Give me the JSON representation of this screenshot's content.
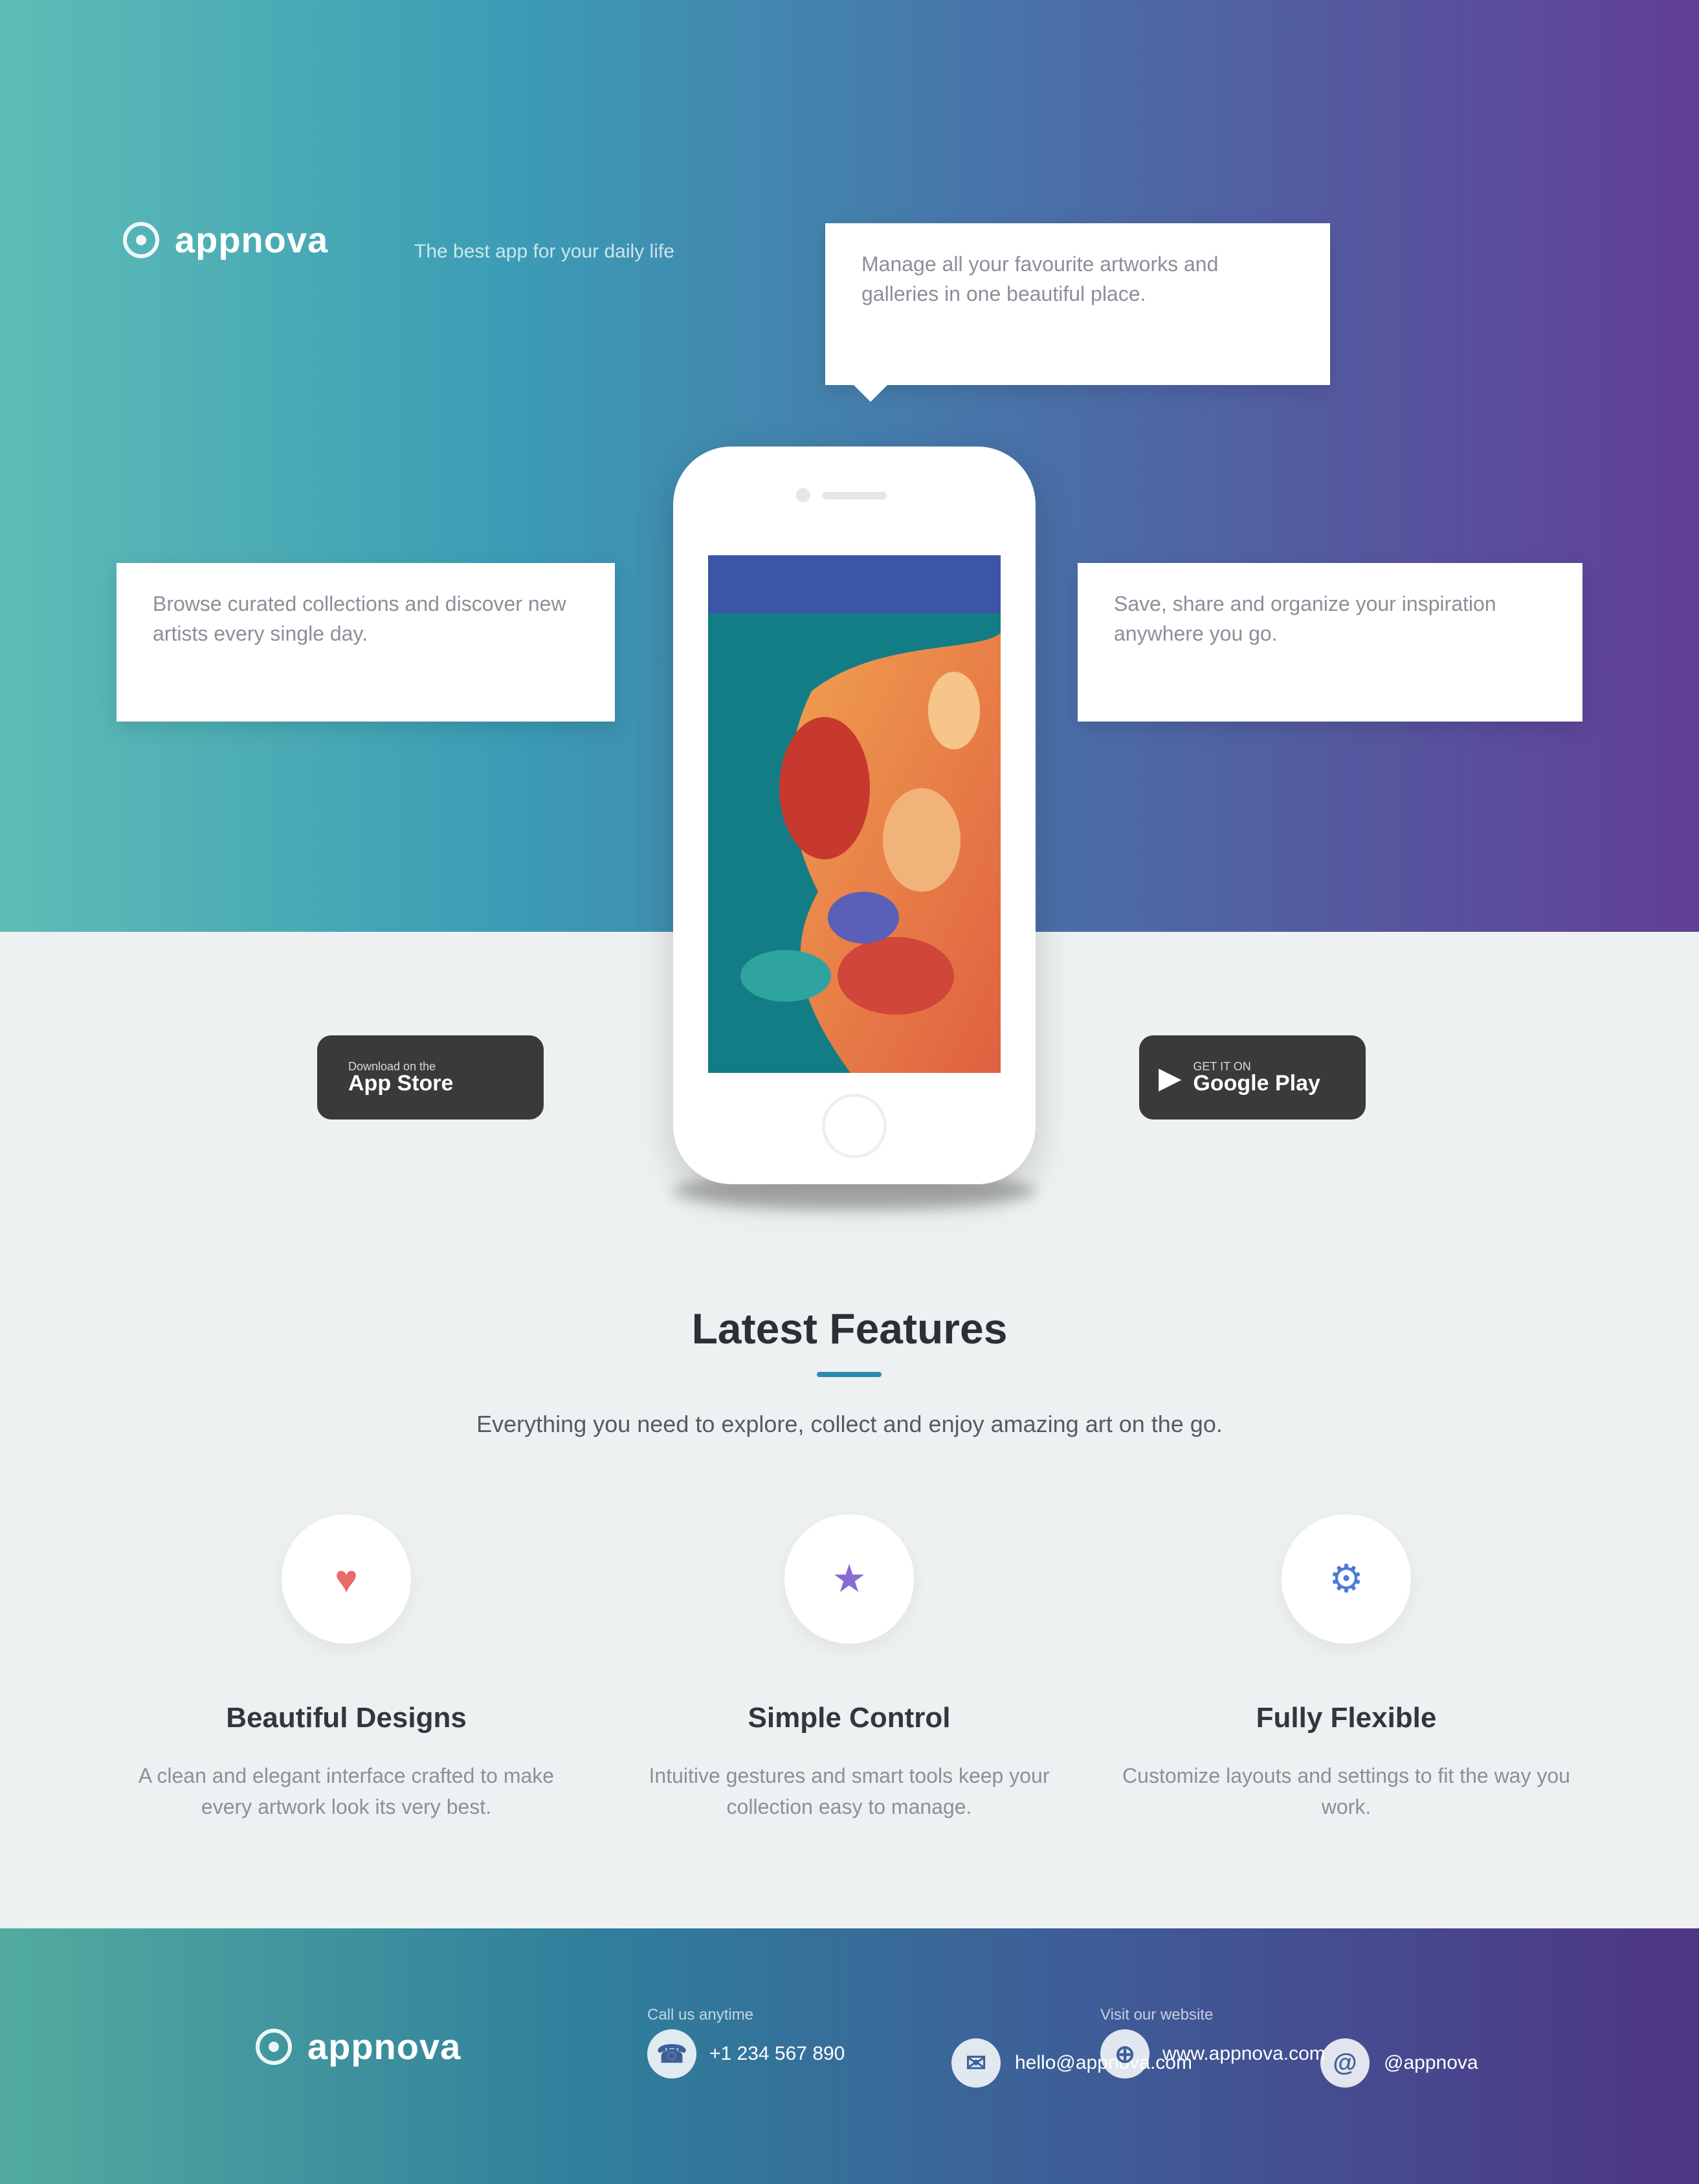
{
  "brand": {
    "name": "appnova",
    "tagline": "The best app for your daily life"
  },
  "callouts": {
    "top": "Manage all your favourite artworks and galleries in one beautiful place.",
    "left": "Browse curated collections and discover new artists every single day.",
    "right": "Save, share and organize your inspiration anywhere you go."
  },
  "stores": {
    "apple": {
      "small": "Download on the",
      "big": "App Store"
    },
    "google": {
      "small": "GET IT ON",
      "big": "Google Play"
    }
  },
  "section": {
    "title": "Latest Features",
    "subtitle": "Everything you need to explore, collect and enjoy amazing art on the go."
  },
  "features": [
    {
      "icon": "heart-icon",
      "glyph": "♥",
      "color": "#e86a6a",
      "title": "Beautiful Designs",
      "desc": "A clean and elegant interface crafted to make every artwork look its very best."
    },
    {
      "icon": "star-icon",
      "glyph": "★",
      "color": "#8a6ad6",
      "title": "Simple Control",
      "desc": "Intuitive gestures and smart tools keep your collection easy to manage."
    },
    {
      "icon": "gear-icon",
      "glyph": "⚙",
      "color": "#4b7bd6",
      "title": "Fully Flexible",
      "desc": "Customize layouts and settings to fit the way you work."
    }
  ],
  "footer": {
    "brand": "appnova",
    "phone_label": "Call us anytime",
    "phone": "+1 234 567 890",
    "mail_label": "Email",
    "mail": "hello@appnova.com",
    "web_label": "Visit our website",
    "web": "www.appnova.com",
    "social": "@appnova"
  },
  "colors": {
    "accent": "#2b8ab0",
    "hero_start": "#5ebdb5",
    "hero_end": "#623e96"
  }
}
